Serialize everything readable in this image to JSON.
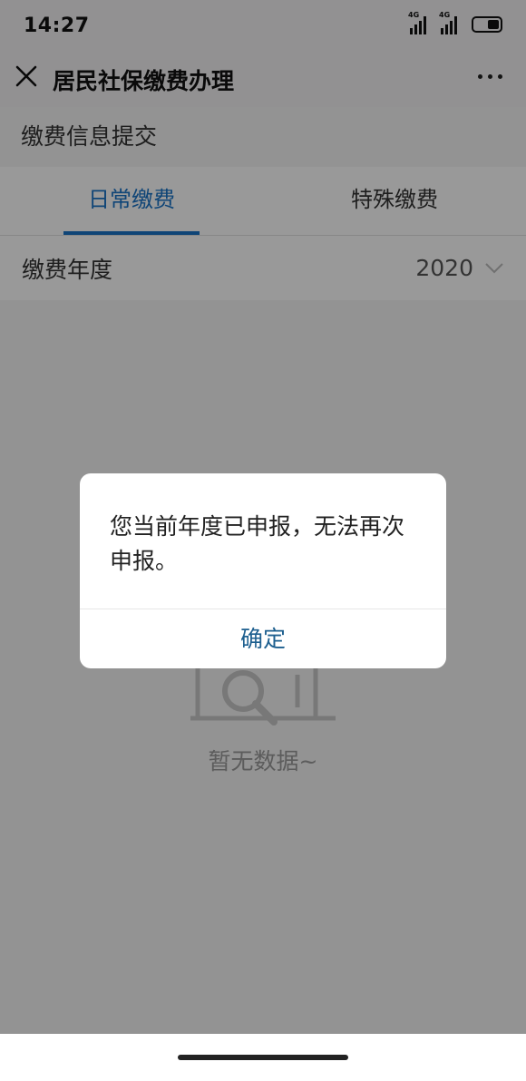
{
  "status_bar": {
    "time": "14:27",
    "signal_label_1": "4G",
    "signal_label_2": "4G",
    "icons": [
      "signal-4g-icon",
      "signal-4g-icon",
      "battery-icon"
    ]
  },
  "nav": {
    "title": "居民社保缴费办理",
    "close_icon": "close-icon",
    "more_icon": "more-icon"
  },
  "page": {
    "section_title": "缴费信息提交",
    "tabs": [
      {
        "label": "日常缴费",
        "active": true
      },
      {
        "label": "特殊缴费",
        "active": false
      }
    ],
    "year_row": {
      "label": "缴费年度",
      "value": "2020",
      "icon": "chevron-down-icon"
    },
    "empty": {
      "text": "暂无数据~",
      "icon": "empty-search-icon"
    }
  },
  "dialog": {
    "message": "您当前年度已申报，无法再次申报。",
    "confirm_label": "确定"
  },
  "colors": {
    "accent": "#1a73c7",
    "dialog_button": "#1d5f8f",
    "overlay": "rgba(0,0,0,0.4)"
  }
}
